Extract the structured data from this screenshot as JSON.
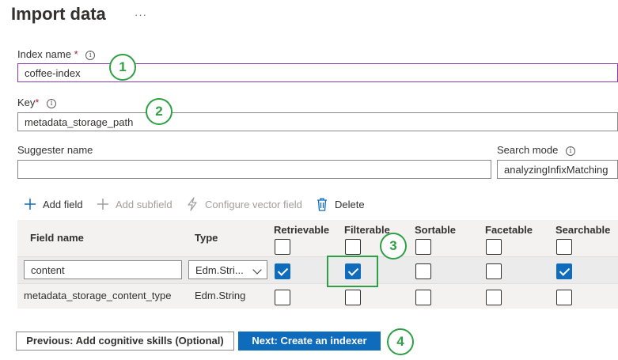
{
  "page": {
    "title": "Import data",
    "more_label": "···"
  },
  "index_name": {
    "label": "Index name",
    "required_mark": "*",
    "value": "coffee-index"
  },
  "key": {
    "label": "Key",
    "required_mark": "*",
    "value": "metadata_storage_path"
  },
  "suggester": {
    "label": "Suggester name",
    "value": ""
  },
  "search_mode": {
    "label": "Search mode",
    "value": "analyzingInfixMatching"
  },
  "info_glyph": "i",
  "toolbar": {
    "add_field": "Add field",
    "add_subfield": "Add subfield",
    "configure_vector_field": "Configure vector field",
    "delete": "Delete"
  },
  "grid": {
    "headers": {
      "field_name": "Field name",
      "type": "Type",
      "retrievable": "Retrievable",
      "filterable": "Filterable",
      "sortable": "Sortable",
      "facetable": "Facetable",
      "searchable": "Searchable"
    },
    "rows": [
      {
        "field_name": "content",
        "type": "Edm.Stri...",
        "retrievable": true,
        "filterable": true,
        "sortable": false,
        "facetable": false,
        "searchable": true
      },
      {
        "field_name": "metadata_storage_content_type",
        "type": "Edm.String",
        "retrievable": false,
        "filterable": false,
        "sortable": false,
        "facetable": false,
        "searchable": false
      }
    ]
  },
  "buttons": {
    "previous": "Previous: Add cognitive skills (Optional)",
    "next": "Next: Create an indexer"
  },
  "callouts": [
    "1",
    "2",
    "3",
    "4"
  ],
  "colors": {
    "accent": "#0f6cbd",
    "callout": "#2ea043",
    "focus_border": "#8a3aa8",
    "required": "#a4262c"
  }
}
